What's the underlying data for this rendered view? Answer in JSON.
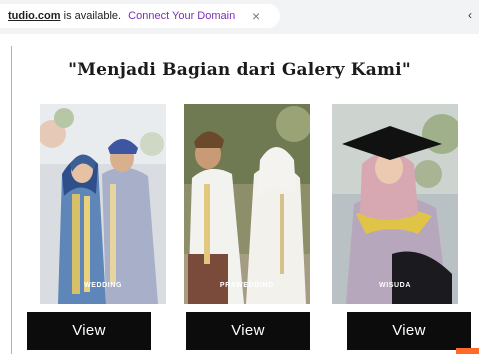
{
  "banner": {
    "domain": "tudio.com",
    "text": "is available.",
    "link": "Connect Your Domain",
    "close": "×"
  },
  "heading": "\"Menjadi Bagian dari Galery Kami\"",
  "gallery": [
    {
      "label": "WEDDING",
      "button": "View"
    },
    {
      "label": "PRAWEDDING",
      "button": "View"
    },
    {
      "label": "WISUDA",
      "button": "View"
    }
  ]
}
